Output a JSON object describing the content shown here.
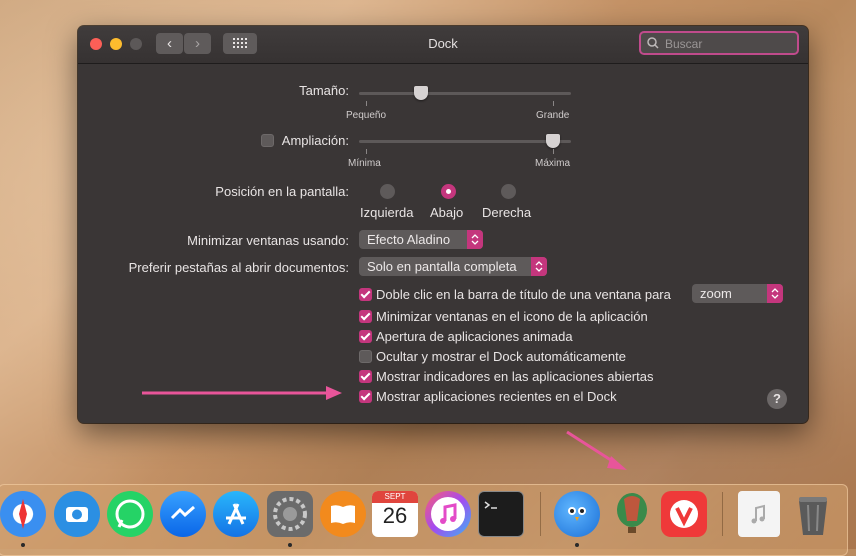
{
  "window": {
    "title": "Dock",
    "search_placeholder": "Buscar"
  },
  "size": {
    "label": "Tamaño:",
    "min_label": "Pequeño",
    "max_label": "Grande",
    "value_fraction": 0.32
  },
  "magnification": {
    "label": "Ampliación:",
    "checked": false,
    "min_label": "Mínima",
    "max_label": "Máxima",
    "value_fraction": 1.0
  },
  "position": {
    "label": "Posición en la pantalla:",
    "options": [
      "Izquierda",
      "Abajo",
      "Derecha"
    ],
    "selected": "Abajo"
  },
  "minimize": {
    "label": "Minimizar ventanas usando:",
    "value": "Efecto Aladino"
  },
  "tabs": {
    "label": "Preferir pestañas al abrir documentos:",
    "value": "Solo en pantalla completa"
  },
  "options": [
    {
      "label": "Doble clic en la barra de título de una ventana para",
      "checked": true
    },
    {
      "label": "Minimizar ventanas en el icono de la aplicación",
      "checked": true
    },
    {
      "label": "Apertura de aplicaciones animada",
      "checked": true
    },
    {
      "label": "Ocultar y mostrar el Dock automáticamente",
      "checked": false
    },
    {
      "label": "Mostrar indicadores en las aplicaciones abiertas",
      "checked": true
    },
    {
      "label": "Mostrar aplicaciones recientes en el Dock",
      "checked": true
    }
  ],
  "doubleclick_action": "zoom",
  "help_label": "?",
  "dock": {
    "calendar_month": "SEPT",
    "calendar_day": "26",
    "apps": [
      "Safari",
      "Screenshot",
      "WhatsApp",
      "Messenger",
      "App Store",
      "System Preferences",
      "Books",
      "Calendar",
      "iTunes",
      "Terminal",
      "Tweetbot",
      "Balloon",
      "Vivaldi",
      "Documents",
      "Trash"
    ]
  },
  "colors": {
    "accent": "#c4367d",
    "annotation_arrow": "#e8559a"
  }
}
